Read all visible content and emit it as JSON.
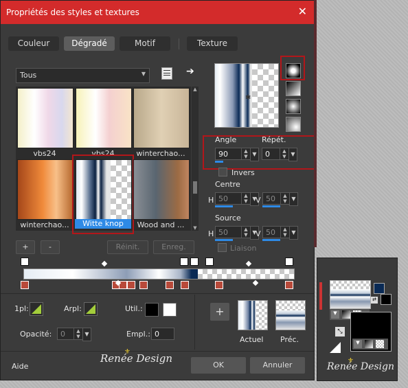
{
  "window": {
    "title": "Propriétés des styles et textures",
    "close_glyph": "✕"
  },
  "tabs": [
    {
      "label": "Couleur"
    },
    {
      "label": "Dégradé"
    },
    {
      "label": "Motif"
    },
    {
      "label": "Texture"
    }
  ],
  "category": {
    "selected": "Tous"
  },
  "gradients": [
    {
      "label": "vbs24"
    },
    {
      "label": "vbs24"
    },
    {
      "label": "winterchao..."
    },
    {
      "label": "winterchao..."
    },
    {
      "label": "Witte knop"
    },
    {
      "label": "Wood and ..."
    }
  ],
  "actions": {
    "add": "+",
    "remove": "-",
    "reset": "Réinit.",
    "save": "Enreg."
  },
  "angle": {
    "label": "Angle",
    "value": "90"
  },
  "repeat": {
    "label": "Répét.",
    "value": "0"
  },
  "invert": {
    "label": "Invers"
  },
  "center": {
    "label": "Centre",
    "h_label": "H",
    "h_value": "50",
    "v_label": "V",
    "v_value": "50"
  },
  "source": {
    "label": "Source",
    "h_label": "H",
    "h_value": "50",
    "v_label": "V",
    "v_value": "50"
  },
  "link": {
    "label": "Liaison"
  },
  "stop_controls": {
    "first_label": "1pl:",
    "arpl_label": "Arpl:",
    "util_label": "Util.:",
    "opacity_label": "Opacité:",
    "opacity_value": "0",
    "empl_label": "Empl.:",
    "empl_value": "0"
  },
  "preview": {
    "plus": "+",
    "current_label": "Actuel",
    "prev_label": "Préc."
  },
  "footer": {
    "help": "Aide",
    "ok": "OK",
    "cancel": "Annuler"
  },
  "watermark": {
    "text": "Renée Design"
  },
  "colors": {
    "accent_red": "#d32b2b",
    "selection_blue": "#2e8ae6",
    "highlight_box": "#b3161a"
  }
}
